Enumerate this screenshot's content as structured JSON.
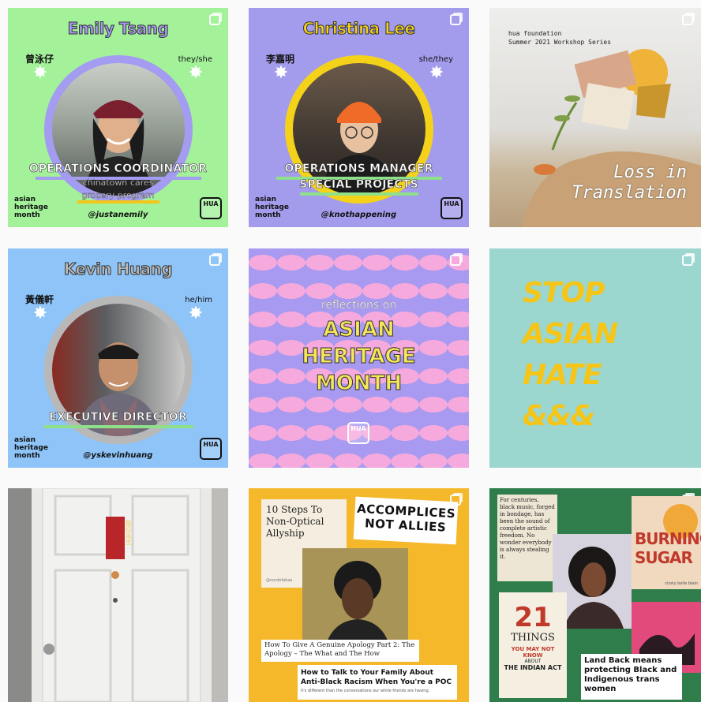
{
  "posts": [
    {
      "name": "Emily Tsang",
      "chinese": "曾泳仔",
      "pronouns": "they/she",
      "role": "OPERATIONS COORDINATOR",
      "sub1": "chinatown cares",
      "sub2": "grocery program",
      "handle": "@justanemily",
      "tag1": "asian",
      "tag2": "heritage",
      "tag3": "month",
      "logo": "HUA"
    },
    {
      "name": "Christina Lee",
      "chinese": "李嘉明",
      "pronouns": "she/they",
      "role": "OPERATIONS MANAGER",
      "sub1": "SPECIAL PROJECTS",
      "handle": "@knothappening",
      "tag1": "asian",
      "tag2": "heritage",
      "tag3": "month",
      "logo": "HUA"
    },
    {
      "org": "hua foundation",
      "series": "Summer 2021 Workshop Series",
      "title1": "Loss in",
      "title2": "Translation"
    },
    {
      "name": "Kevin Huang",
      "chinese": "黃儀軒",
      "pronouns": "he/him",
      "role": "EXECUTIVE DIRECTOR",
      "handle": "@yskevinhuang",
      "tag1": "asian",
      "tag2": "heritage",
      "tag3": "month",
      "logo": "HUA"
    },
    {
      "pre": "reflections on",
      "line1": "ASIAN",
      "line2": "HERITAGE",
      "line3": "MONTH",
      "logo": "HUA"
    },
    {
      "line1": "STOP",
      "line2": "ASIAN",
      "line3": "HATE",
      "line4": "&&&"
    },
    {
      "sign": "鵬程萬里"
    },
    {
      "steps": "10 Steps To Non-Optical Allyship",
      "accomplices1": "ACCOMPLICES",
      "accomplices2": "NOT ALLIES",
      "apology": "How To Give A Genuine Apology Part 2: The Apology – The What and The How",
      "talk": "How to Talk to Your Family About Anti-Black Racism When You're a POC",
      "talk_sub": "It's different than the conversations our white friends are having.",
      "credit": "@nordefakaa"
    },
    {
      "quote": "For centuries, black music, forged in bondage, has been the sound of complete artistic freedom. No wonder everybody is always stealing it.",
      "burning1": "BURNING",
      "burning2": "SUGAR",
      "burning_author": "cicely belle blain",
      "num": "21",
      "things": "THINGS",
      "maynot": "YOU MAY NOT KNOW",
      "about": "ABOUT",
      "indian": "THE INDIAN ACT",
      "landback": "Land Back means protecting Black and Indigenous trans women"
    }
  ]
}
